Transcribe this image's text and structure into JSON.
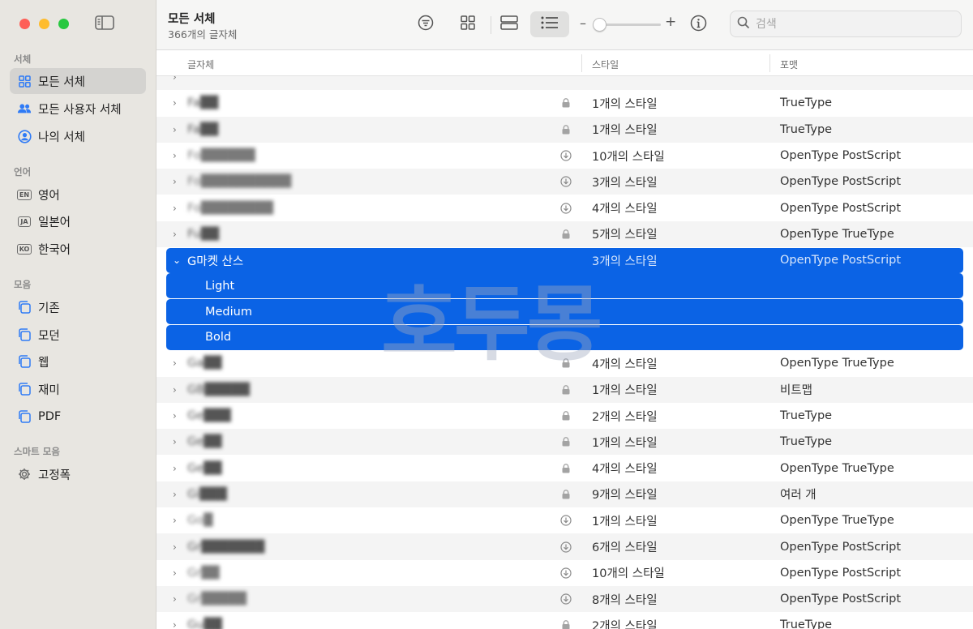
{
  "sidebar": {
    "sections": [
      {
        "title": "서체",
        "items": [
          {
            "label": "모든 서체",
            "icon": "grid-icon",
            "active": true
          },
          {
            "label": "모든 사용자 서체",
            "icon": "people-icon"
          },
          {
            "label": "나의 서체",
            "icon": "person-circle-icon"
          }
        ]
      },
      {
        "title": "언어",
        "items": [
          {
            "label": "영어",
            "badge": "EN"
          },
          {
            "label": "일본어",
            "badge": "JA"
          },
          {
            "label": "한국어",
            "badge": "KO"
          }
        ]
      },
      {
        "title": "모음",
        "items": [
          {
            "label": "기존"
          },
          {
            "label": "모던"
          },
          {
            "label": "웹"
          },
          {
            "label": "재미"
          },
          {
            "label": "PDF"
          }
        ]
      },
      {
        "title": "스마트 모음",
        "items": [
          {
            "label": "고정폭",
            "icon": "gear-icon"
          }
        ]
      }
    ]
  },
  "toolbar": {
    "title": "모든 서체",
    "subtitle": "366개의 글자체",
    "search_placeholder": "검색"
  },
  "table": {
    "headers": {
      "family": "글자체",
      "styles": "스타일",
      "format": "포맷"
    },
    "rows": [
      {
        "name": "Fa██",
        "styles": "1개의 스타일",
        "format": "TrueType",
        "icon": "lock-icon"
      },
      {
        "name": "Fa██",
        "styles": "1개의 스타일",
        "format": "TrueType",
        "icon": "lock-icon"
      },
      {
        "name": "Fo██████",
        "styles": "10개의 스타일",
        "format": "OpenType PostScript",
        "icon": "download-icon"
      },
      {
        "name": "Fo██████████",
        "styles": "3개의 스타일",
        "format": "OpenType PostScript",
        "icon": "download-icon"
      },
      {
        "name": "Fo████████",
        "styles": "4개의 스타일",
        "format": "OpenType PostScript",
        "icon": "download-icon"
      },
      {
        "name": "Fu██",
        "styles": "5개의 스타일",
        "format": "OpenType TrueType",
        "icon": "lock-icon"
      }
    ],
    "selected": {
      "name": "G마켓 산스",
      "styles": "3개의 스타일",
      "format": "OpenType PostScript",
      "sub_styles": [
        "Light",
        "Medium",
        "Bold"
      ]
    },
    "rows_after": [
      {
        "name": "Ga██",
        "styles": "4개의 스타일",
        "format": "OpenType TrueType",
        "icon": "lock-icon"
      },
      {
        "name": "GB█████",
        "styles": "1개의 스타일",
        "format": "비트맵",
        "icon": "lock-icon"
      },
      {
        "name": "Ge███",
        "styles": "2개의 스타일",
        "format": "TrueType",
        "icon": "lock-icon"
      },
      {
        "name": "Ge██",
        "styles": "1개의 스타일",
        "format": "TrueType",
        "icon": "lock-icon"
      },
      {
        "name": "Ge██",
        "styles": "4개의 스타일",
        "format": "OpenType TrueType",
        "icon": "lock-icon"
      },
      {
        "name": "Gi███",
        "styles": "9개의 스타일",
        "format": "여러 개",
        "icon": "lock-icon"
      },
      {
        "name": "Go█",
        "styles": "1개의 스타일",
        "format": "OpenType TrueType",
        "icon": "download-icon"
      },
      {
        "name": "Gr███████",
        "styles": "6개의 스타일",
        "format": "OpenType PostScript",
        "icon": "download-icon"
      },
      {
        "name": "Gr██",
        "styles": "10개의 스타일",
        "format": "OpenType PostScript",
        "icon": "download-icon"
      },
      {
        "name": "Gr█████",
        "styles": "8개의 스타일",
        "format": "OpenType PostScript",
        "icon": "download-icon"
      },
      {
        "name": "Gu██",
        "styles": "2개의 스타일",
        "format": "TrueType",
        "icon": "lock-icon"
      }
    ]
  },
  "watermark": "호두몽"
}
